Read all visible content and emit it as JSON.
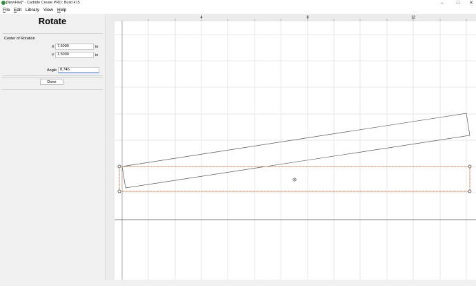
{
  "window": {
    "title": "[NewFile]* - Carbide Create PRO: Build 415",
    "minimize_glyph": "–",
    "maximize_glyph": "□",
    "close_glyph": "✕"
  },
  "menu": {
    "file": {
      "key": "F",
      "rest": "ile"
    },
    "edit": {
      "key": "E",
      "rest": "dit"
    },
    "library": {
      "key": "",
      "rest": "Library"
    },
    "view": {
      "key": "",
      "rest": "View"
    },
    "help": {
      "key": "H",
      "rest": "elp"
    }
  },
  "panel": {
    "title": "Rotate",
    "center_label": "Center of Rotation",
    "x_label": "X",
    "x_value": "7.5000",
    "y_label": "Y",
    "y_value": "1.5000",
    "unit": "in",
    "angle_label": "Angle",
    "angle_value": "8.746",
    "done_label": "Done"
  },
  "canvas": {
    "ruler_labels": [
      "4",
      "8",
      "12"
    ],
    "grid_color": "#d4d4d4",
    "selection_color": "#e8732a",
    "shape_color": "#555555"
  }
}
